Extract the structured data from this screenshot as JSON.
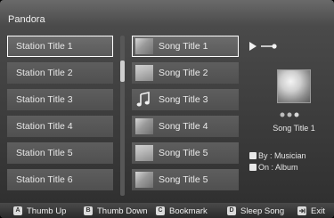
{
  "app": {
    "title": "Pandora"
  },
  "stations": [
    {
      "label": "Station Title 1",
      "selected": true
    },
    {
      "label": "Station Title 2",
      "selected": false
    },
    {
      "label": "Station Title 3",
      "selected": false
    },
    {
      "label": "Station Title 4",
      "selected": false
    },
    {
      "label": "Station Title 5",
      "selected": false
    },
    {
      "label": "Station Title 6",
      "selected": false
    }
  ],
  "songs": [
    {
      "label": "Song Title 1",
      "thumb": "album-thumb",
      "selected": true
    },
    {
      "label": "Song Title 2",
      "thumb": "album-thumb",
      "selected": false
    },
    {
      "label": "Song Title 3",
      "thumb": "music-note-icon",
      "selected": false
    },
    {
      "label": "Song Title 4",
      "thumb": "album-thumb",
      "selected": false
    },
    {
      "label": "Song Title 5",
      "thumb": "album-thumb",
      "selected": false
    },
    {
      "label": "Song Title 5",
      "thumb": "album-thumb",
      "selected": false
    }
  ],
  "now_playing": {
    "title": "Song Title 1",
    "by": "By : Musician",
    "on": "On : Album"
  },
  "bottom_bar": [
    {
      "key": "A",
      "label": "Thumb Up"
    },
    {
      "key": "B",
      "label": "Thumb Down"
    },
    {
      "key": "C",
      "label": "Bookmark"
    },
    {
      "key": "D",
      "label": "Sleep Song"
    },
    {
      "key": "exit-icon",
      "label": "Exit"
    }
  ],
  "colors": {
    "background": "#3c3c3c",
    "row": "#575757",
    "selected_border": "#ffffff",
    "text": "#eaeaea"
  }
}
